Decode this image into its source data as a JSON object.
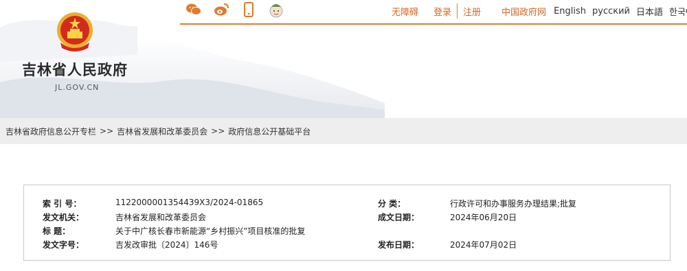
{
  "site": {
    "title": "吉林省人民政府",
    "domain": "JL.GOV.CN"
  },
  "topbar": {
    "icons": [
      "wechat-icon",
      "weibo-icon",
      "mobile-icon",
      "avatar-icon"
    ],
    "accessibility": "无障碍",
    "login": "登录",
    "register": "注册",
    "gov_link": "中国政府网",
    "lang_en": "English",
    "lang_ru": "русский",
    "lang_ja": "日本語",
    "lang_ko": "한국어",
    "accent_color": "#d9651e"
  },
  "breadcrumb": {
    "items": [
      "吉林省政府信息公开专栏",
      "吉林省发展和改革委员会",
      "政府信息公开基础平台"
    ],
    "separator": ">>"
  },
  "info": {
    "index_label": "索 引 号：",
    "index_value": "11220000013544​39X3/2024-01865",
    "category_label": "分  类：",
    "category_value": "行政许可和办事服务办理结果;批复",
    "issuer_label": "发文机关：",
    "issuer_value": "吉林省发展和改革委员会",
    "date_label": "成文日期：",
    "date_value": "2024年06月20日",
    "title_label": "标    题：",
    "title_value": "关于中广核长春市新能源“乡村振兴”项目核准的批复",
    "docno_label": "发文字号：",
    "docno_value": "吉发改审批〔2024〕146号",
    "pubdate_label": "发布日期：",
    "pubdate_value": "2024年07月02日"
  }
}
